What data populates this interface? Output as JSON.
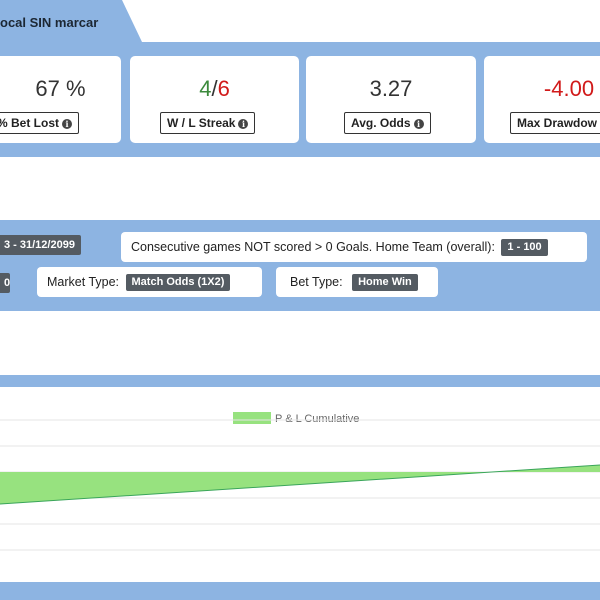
{
  "header": {
    "title": "ocal SIN marcar"
  },
  "stats": {
    "bet_lost": {
      "value": "67 %",
      "label": "% Bet Lost"
    },
    "wl_streak": {
      "wins": "4",
      "separator": "/",
      "losses": "6",
      "label": "W / L Streak"
    },
    "avg_odds": {
      "value": "3.27",
      "label": "Avg. Odds"
    },
    "max_drawdown": {
      "value": "-4.00",
      "label": "Max Drawdow"
    }
  },
  "filters": {
    "date_range": "3 - 31/12/2099",
    "consecutive_label": "Consecutive games NOT scored > 0 Goals. Home Team (overall):",
    "consecutive_value": "1 - 100",
    "left_partial": "0",
    "market_type_label": "Market Type:",
    "market_type_value": "Match Odds (1X2)",
    "bet_type_label": "Bet Type:",
    "bet_type_value": "Home Win"
  },
  "chart_data": {
    "type": "area",
    "series": [
      {
        "name": "P & L Cumulative",
        "color": "#97e27f"
      }
    ],
    "grid": true
  },
  "colors": {
    "band": "#8db4e2",
    "win": "#3c8a3c",
    "loss": "#d11a1a",
    "area_fill": "#97e27f",
    "area_line": "#3aa55a"
  },
  "icons": {
    "info": "info-circle-icon"
  }
}
